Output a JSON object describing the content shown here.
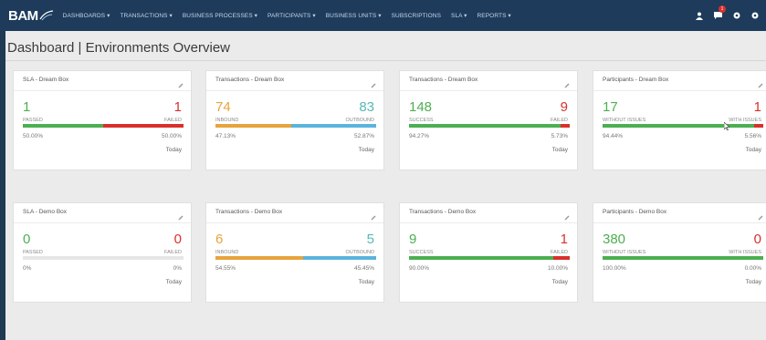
{
  "app": {
    "logo_text": "BAM"
  },
  "colors": {
    "navbar": "#1e3b5c",
    "green": "#4caf50",
    "red": "#d9302b",
    "orange": "#e8a33c",
    "blue": "#5ab4dc",
    "teal": "#57b8b5"
  },
  "nav": {
    "items": [
      "DASHBOARDS ▾",
      "TRANSACTIONS ▾",
      "BUSINESS PROCESSES ▾",
      "PARTICIPANTS ▾",
      "BUSINESS UNITS ▾",
      "SUBSCRIPTIONS",
      "SLA ▾",
      "REPORTS ▾"
    ],
    "notification_count": "1",
    "right_icons": [
      "user-icon",
      "chat-icon",
      "settings-icon",
      "gear-icon"
    ]
  },
  "page": {
    "title": "Dashboard | Environments Overview"
  },
  "cards": [
    {
      "title": "SLA - Dream Box",
      "left_value": "1",
      "right_value": "1",
      "left_label": "PASSED",
      "right_label": "FAILED",
      "left_pct": "50.00%",
      "right_pct": "50.00%",
      "left_fraction": 0.5,
      "left_color": "#4caf50",
      "right_color": "#d9302b",
      "left_value_color": "#4caf50",
      "right_value_color": "#d9302b",
      "footer": "Today"
    },
    {
      "title": "Transactions - Dream Box",
      "left_value": "74",
      "right_value": "83",
      "left_label": "INBOUND",
      "right_label": "OUTBOUND",
      "left_pct": "47.13%",
      "right_pct": "52.87%",
      "left_fraction": 0.4713,
      "left_color": "#e8a33c",
      "right_color": "#5ab4dc",
      "left_value_color": "#e8a33c",
      "right_value_color": "#57b8b5",
      "footer": "Today"
    },
    {
      "title": "Transactions - Dream Box",
      "left_value": "148",
      "right_value": "9",
      "left_label": "SUCCESS",
      "right_label": "FAILED",
      "left_pct": "94.27%",
      "right_pct": "5.73%",
      "left_fraction": 0.9427,
      "left_color": "#4caf50",
      "right_color": "#d9302b",
      "left_value_color": "#4caf50",
      "right_value_color": "#d9302b",
      "footer": "Today"
    },
    {
      "title": "Participants - Dream Box",
      "left_value": "17",
      "right_value": "1",
      "left_label": "WITHOUT ISSUES",
      "right_label": "WITH ISSUES",
      "left_pct": "94.44%",
      "right_pct": "5.56%",
      "left_fraction": 0.9444,
      "left_color": "#4caf50",
      "right_color": "#d9302b",
      "left_value_color": "#4caf50",
      "right_value_color": "#d9302b",
      "footer": "Today"
    },
    {
      "title": "SLA - Demo Box",
      "left_value": "0",
      "right_value": "0",
      "left_label": "PASSED",
      "right_label": "FAILED",
      "left_pct": "0%",
      "right_pct": "0%",
      "left_fraction": 0,
      "left_color": "#4caf50",
      "right_color": "#e6e6e6",
      "left_value_color": "#4caf50",
      "right_value_color": "#d9302b",
      "footer": "Today"
    },
    {
      "title": "Transactions - Demo Box",
      "left_value": "6",
      "right_value": "5",
      "left_label": "INBOUND",
      "right_label": "OUTBOUND",
      "left_pct": "54.55%",
      "right_pct": "45.45%",
      "left_fraction": 0.5455,
      "left_color": "#e8a33c",
      "right_color": "#5ab4dc",
      "left_value_color": "#e8a33c",
      "right_value_color": "#57b8b5",
      "footer": "Today"
    },
    {
      "title": "Transactions - Demo Box",
      "left_value": "9",
      "right_value": "1",
      "left_label": "SUCCESS",
      "right_label": "FAILED",
      "left_pct": "90.00%",
      "right_pct": "10.00%",
      "left_fraction": 0.9,
      "left_color": "#4caf50",
      "right_color": "#d9302b",
      "left_value_color": "#4caf50",
      "right_value_color": "#d9302b",
      "footer": "Today"
    },
    {
      "title": "Participants - Demo Box",
      "left_value": "380",
      "right_value": "0",
      "left_label": "WITHOUT ISSUES",
      "right_label": "WITH ISSUES",
      "left_pct": "100.00%",
      "right_pct": "0.00%",
      "left_fraction": 1.0,
      "left_color": "#4caf50",
      "right_color": "#d9302b",
      "left_value_color": "#4caf50",
      "right_value_color": "#d9302b",
      "footer": "Today"
    }
  ]
}
